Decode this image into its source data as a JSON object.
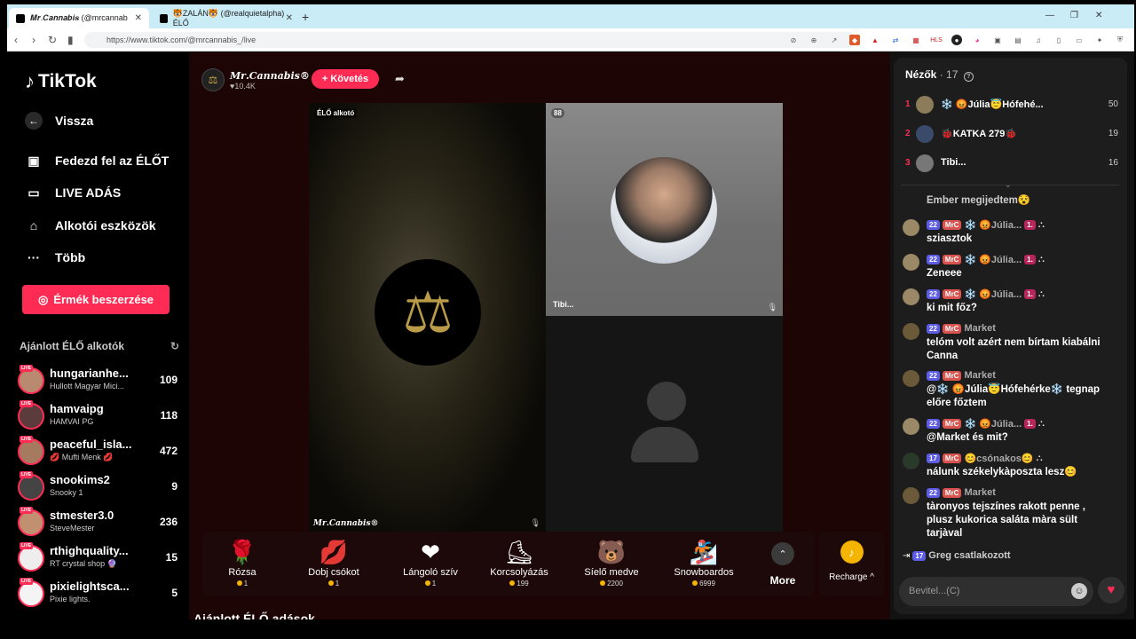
{
  "browser": {
    "tabs": [
      {
        "title": "𝑴𝒓.𝑪𝒂𝒏𝒏𝒂𝒃𝒊𝒔 (@mrcannab",
        "active": true
      },
      {
        "title": "🐯ZALÁN🐯 (@realquietalpha) ÉLŐ",
        "active": false
      }
    ],
    "newtab": "+",
    "url": "https://www.tiktok.com/@mrcannabis_/live"
  },
  "nav": {
    "logo": "TikTok",
    "back": "Vissza",
    "items": [
      {
        "label": "Fedezd fel az ÉLŐT",
        "icon": "live-tv-icon"
      },
      {
        "label": "LIVE ADÁS",
        "icon": "video-camera-icon"
      },
      {
        "label": "Alkotói eszközök",
        "icon": "creator-tools-icon"
      },
      {
        "label": "Több",
        "icon": "more-icon"
      }
    ],
    "coin_button": "Érmék beszerzése",
    "reco_header": "Ajánlott ÉLŐ alkotók",
    "creators": [
      {
        "name": "hungarianhe...",
        "sub": "Hullott Magyar Mici...",
        "count": "109"
      },
      {
        "name": "hamvaipg",
        "sub": "HAMVAI PG",
        "count": "118"
      },
      {
        "name": "peaceful_isla...",
        "sub": "💋 Mufti Menk 💋",
        "count": "472"
      },
      {
        "name": "snookims2",
        "sub": "Snooky 1",
        "count": "9"
      },
      {
        "name": "stmester3.0",
        "sub": "SteveMester",
        "count": "236"
      },
      {
        "name": "rthighquality...",
        "sub": "RT crystal shop 🔮",
        "count": "15"
      },
      {
        "name": "pixielightsca...",
        "sub": "Pixie lights.",
        "count": "5"
      }
    ],
    "live_badge": "LIVE"
  },
  "stream": {
    "name": "𝑴𝒓.𝑪𝒂𝒏𝒏𝒂𝒃𝒊𝒔®",
    "likes": "♥10.4K",
    "follow": "+ Követés",
    "left_tag": "ÉLŐ alkotó",
    "watermark": "𝑴𝒓.𝑪𝒂𝒏𝒏𝒂𝒃𝒊𝒔®",
    "guest_badge": "88",
    "guest_name": "Tibi..."
  },
  "gifts": [
    {
      "name": "Rózsa",
      "price": "1",
      "icon": "🌹"
    },
    {
      "name": "Dobj csókot",
      "price": "1",
      "icon": "💋"
    },
    {
      "name": "Lángoló szív",
      "price": "1",
      "icon": "❤️‍🔥"
    },
    {
      "name": "Korcsolyázás",
      "price": "199",
      "icon": "⛸"
    },
    {
      "name": "Síelő medve",
      "price": "2200",
      "icon": "🐻"
    },
    {
      "name": "Snowboardos",
      "price": "6999",
      "icon": "🏂"
    }
  ],
  "more_label": "More",
  "recharge_label": "Recharge ^",
  "below_heading": "Ajánlott ÉLŐ adások",
  "viewers": {
    "label": "Nézők",
    "count": "· 17",
    "list": [
      {
        "rank": "1",
        "name": "❄️ 😡Júlia😇Hófehé...",
        "score": "50"
      },
      {
        "rank": "2",
        "name": "🐞KATKA 279🐞",
        "score": "19"
      },
      {
        "rank": "3",
        "name": "Tibi...",
        "score": "16"
      }
    ]
  },
  "chat": {
    "first_line": "Ember megijedtem😵",
    "messages": [
      {
        "lvl": "22",
        "user": "❄️ 😡Júlia...",
        "fan": "1.",
        "text": "sziasztok"
      },
      {
        "lvl": "22",
        "user": "❄️ 😡Júlia...",
        "fan": "1.",
        "text": "Zeneee"
      },
      {
        "lvl": "22",
        "user": "❄️ 😡Júlia...",
        "fan": "1.",
        "text": "ki mit főz?"
      },
      {
        "lvl": "22",
        "user": "Market",
        "fan": "",
        "text": "telóm volt azért nem bírtam kiabálni Canna"
      },
      {
        "lvl": "22",
        "user": "Market",
        "fan": "",
        "text": "@❄️ 😡Júlia😇Hófehérke❄️ tegnap előre főztem"
      },
      {
        "lvl": "22",
        "user": "❄️ 😡Júlia...",
        "fan": "1.",
        "text": "@Market és mit?"
      },
      {
        "lvl": "17",
        "user": "😊csónakos😊",
        "fan": "",
        "text": "nálunk székelykàposzta lesz😊"
      },
      {
        "lvl": "22",
        "user": "Market",
        "fan": "",
        "text": "tàronyos tejszínes rakott penne , plusz kukorica saláta màra sült tarjàval"
      }
    ],
    "mrc_badge": "MrC",
    "join": {
      "lvl": "17",
      "text": "Greg csatlakozott"
    },
    "input_placeholder": "Bevitel...(C)"
  },
  "colors": {
    "accent": "#fe2c55",
    "level_badge": "#5d5ce6",
    "coin": "#f5b400"
  }
}
